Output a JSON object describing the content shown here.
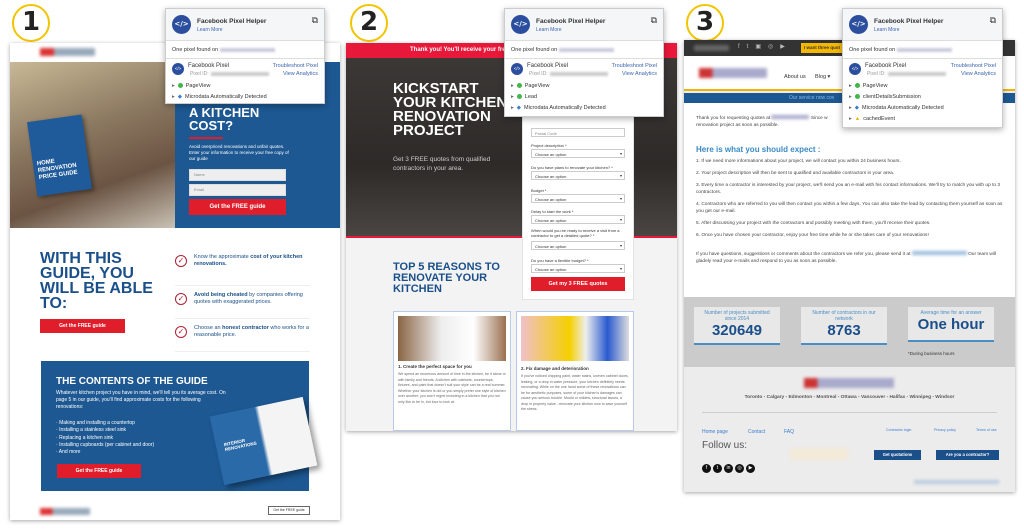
{
  "steps": [
    "1",
    "2",
    "3"
  ],
  "pixel_helper": {
    "title": "Facebook Pixel Helper",
    "learn_more": "Learn More",
    "found": "One pixel found on",
    "pixel_name": "Facebook Pixel",
    "pixel_id_label": "Pixel ID:",
    "troubleshoot": "Troubleshoot Pixel",
    "view_analytics": "View Analytics",
    "popups": [
      {
        "events": [
          {
            "name": "PageView",
            "status": "green"
          },
          {
            "name": "Microdata Automatically Detected",
            "status": "blue"
          }
        ]
      },
      {
        "events": [
          {
            "name": "PageView",
            "status": "green"
          },
          {
            "name": "Lead",
            "status": "green"
          },
          {
            "name": "Microdata Automatically Detected",
            "status": "blue"
          }
        ]
      },
      {
        "events": [
          {
            "name": "PageView",
            "status": "green"
          },
          {
            "name": "clientDetailsSubmission",
            "status": "green"
          },
          {
            "name": "Microdata Automatically Detected",
            "status": "blue"
          },
          {
            "name": "cachedEvent",
            "status": "warning"
          }
        ]
      }
    ]
  },
  "colors": {
    "brand_blue": "#1a4f8a",
    "cta_red": "#e01e2b",
    "green": "#43b649",
    "blue": "#3b7bd0",
    "warning": "#f0b400",
    "link": "#3b64b0"
  },
  "page1": {
    "hero_title": "A KITCHEN COST?",
    "hero_text": "Avoid overpriced renovations and unfair quotes. Enter your information to receive your free copy of our guide",
    "name_placeholder": "Name",
    "email_placeholder": "Email",
    "cta": "Get the FREE guide",
    "book_title": "HOME RENOVATION PRICE GUIDE",
    "benefits_title": "WITH THIS GUIDE, YOU WILL BE ABLE TO:",
    "benefits": [
      {
        "pre": "Know the approximate ",
        "bold": "cost of your kitchen renovations.",
        "post": ""
      },
      {
        "pre": "",
        "bold": "Avoid being cheated",
        "post": " by companies offering quotes with exaggerated prices."
      },
      {
        "pre": "Choose an ",
        "bold": "honest contractor",
        "post": " who works for a reasonable price."
      }
    ],
    "contents_title": "THE CONTENTS OF THE GUIDE",
    "contents_text": "Whatever kitchen project you have in mind, we'll tell you its average cost. On page 5 in our guide, you'll find approximate costs for the following renovations:",
    "contents_list": [
      "Making and installing a countertop",
      "Installing a stainless steel sink",
      "Replacing a kitchen sink",
      "Installing cupboards (per cabinet and door)",
      "And more"
    ],
    "open_book_title": "INTERIOR RENOVATIONS",
    "footer_button": "Get the FREE guide"
  },
  "page2": {
    "banner": "Thank you! You'll receive your fre",
    "hero_title": "KICKSTART YOUR KITCHEN RENOVATION PROJECT",
    "hero_sub": "Get 3 FREE quotes from qualified contractors in your area.",
    "postal_placeholder": "Postal Code",
    "fields": [
      {
        "label": "Project description *",
        "value": "Choose an option"
      },
      {
        "label": "Do you have plans to renovate your kitchen? *",
        "value": "Choose an option"
      },
      {
        "label": "Budget *",
        "value": "Choose an option"
      },
      {
        "label": "Delay to start the work *",
        "value": "Choose an option"
      },
      {
        "label": "When would you be ready to receive a visit from a contractor to get a detailed quote? *",
        "value": "Choose an option"
      },
      {
        "label": "Do you have a flexible budget? *",
        "value": "Choose an option"
      }
    ],
    "submit": "Get my 3 FREE quotes",
    "reasons_title": "TOP 5 REASONS TO RENOVATE YOUR KITCHEN",
    "cards": [
      {
        "title": "1.  Create the perfect space for you",
        "text": "We spend an enormous amount of time in the kitchen, be it alone or with family and friends. A kitchen with cabinets, countertops, fixtures, and paint that doesn't suit your style can be a real bummer. Whether your kitchen is old or you simply prefer one style of kitchen over another, you won't regret investing in a kitchen that you not only like to be in, but love to look at."
      },
      {
        "title": "2. Fix damage and deterioration",
        "text": "If you've noticed chipping paint, water stains, uneven cabinet doors, leaking, or a drop in water pressure, your kitchen definitely needs renovating. While on the one hand some of these renovations can be for aesthetic purposes, some of your kitchen's damages can cause you serious trouble. Mould or mildew, structural issues, a drop in property value...renovate your kitchen now to save yourself the stress."
      }
    ]
  },
  "page3": {
    "top_cta": "I want three quot",
    "nav": [
      "About us",
      "Blog ▾"
    ],
    "banner": "Our service now cov",
    "intro": "Thank you for requesting quotes at",
    "intro2": "Since w",
    "intro3": "renovation project as soon as possible.",
    "expect_title": "Here is what you should expect :",
    "steps": [
      "1. If we need more informations about your project, we will contact you within 24 business hours.",
      "2. Your project description will then be sent to qualified and available contractors in your area.",
      "3. Every time a contractor is interested by your project, we'll send you an e-mail with his contact informations. We'll try to match you with up to 3 contractors.",
      "4. Contractors who are referred to you will then contact you within a few days. You can also take the lead by contacting them yourself as soon as you get our e-mail.",
      "5. After discussing your project with the contractors and possibly meeting with them, you'll receive their quotes.",
      "6. Once you have chosen your contractor, enjoy your free time while he or she takes care of your renovations!"
    ],
    "questions": "If you have questions, suggestions or comments about the contractors we refer you, please send it at",
    "questions2": "Our team will gladely read your e-mails and respond to you as soon as possible.",
    "stats": [
      {
        "label": "Number of projects submitted since 2014",
        "value": "320649"
      },
      {
        "label": "Number of contractors in our network",
        "value": "8763"
      },
      {
        "label": "Average time for an answer",
        "value": "One hour"
      }
    ],
    "stats_note": "*During business hours",
    "cities": "Toronto - Calgary - Edmonton - Montreal - Ottawa - Vancouver - Halifax - Winnipeg - Windsor",
    "footer_links": [
      "Home page",
      "Contact",
      "FAQ"
    ],
    "footer_links_right": [
      "Contractor login",
      "Privacy policy",
      "Terms of use"
    ],
    "follow": "Follow us:",
    "social_icons": [
      "facebook-icon",
      "twitter-icon",
      "linkedin-icon",
      "instagram-icon",
      "youtube-icon"
    ],
    "btn_quotes": "Get quotations",
    "btn_contractor": "Are you a contractor?"
  }
}
